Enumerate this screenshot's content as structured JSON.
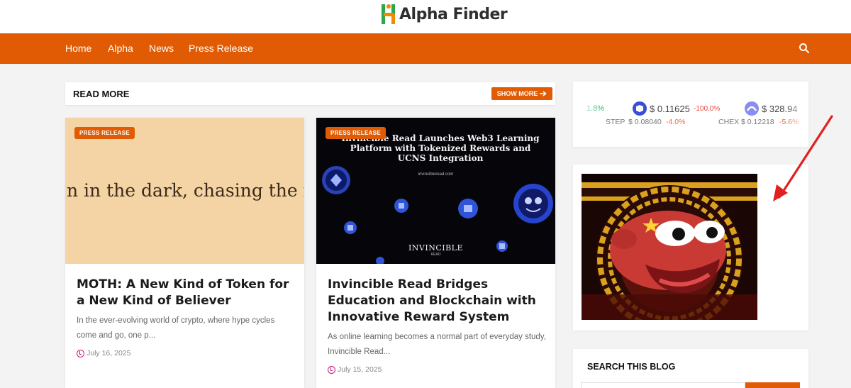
{
  "brand": {
    "name": "Alpha Finder",
    "accent": "#e05b03",
    "logo_colors": [
      "#2aa84a",
      "#f08a00"
    ]
  },
  "nav": {
    "items": [
      {
        "label": "Home"
      },
      {
        "label": "Alpha"
      },
      {
        "label": "News"
      },
      {
        "label": "Press Release"
      }
    ],
    "search_icon": "search-icon"
  },
  "read_more": {
    "title": "READ MORE",
    "show_more_label": "SHOW MORE",
    "show_more_icon": "arrow-right-icon"
  },
  "posts": [
    {
      "badge": "PRESS RELEASE",
      "image_text": "n in the dark, chasing the m",
      "title": "MOTH: A New Kind of Token for a New Kind of Believer",
      "excerpt": "In the ever-evolving world of crypto, where hype cycles come and go, one p...",
      "date": "July 16, 2025"
    },
    {
      "badge": "PRESS RELEASE",
      "image_text": {
        "headline": "Invincible Read Launches Web3 Learning Platform with Tokenized Rewards and UCNS Integration",
        "url": "invincibleread.com",
        "brand": "INVINCIBLE",
        "brand_sub": "READ"
      },
      "title": "Invincible Read Bridges Education and Blockchain with Innovative Reward System",
      "excerpt": "As online learning becomes a normal part of everyday study, Invincible Read...",
      "date": "July 15, 2025"
    }
  ],
  "ticker": {
    "partial_left": "1.8%",
    "coins": [
      {
        "price": "$ 0.11625",
        "change": "-100.0%",
        "symbol": "STEP",
        "sub_price": "$ 0.08040",
        "sub_change": "-4.0%"
      },
      {
        "price": "$ 328.94",
        "symbol": "CHEX",
        "sub_price": "$ 0.12218",
        "sub_change": "-5.6%"
      }
    ]
  },
  "sidebar": {
    "search_title": "SEARCH THIS BLOG"
  }
}
